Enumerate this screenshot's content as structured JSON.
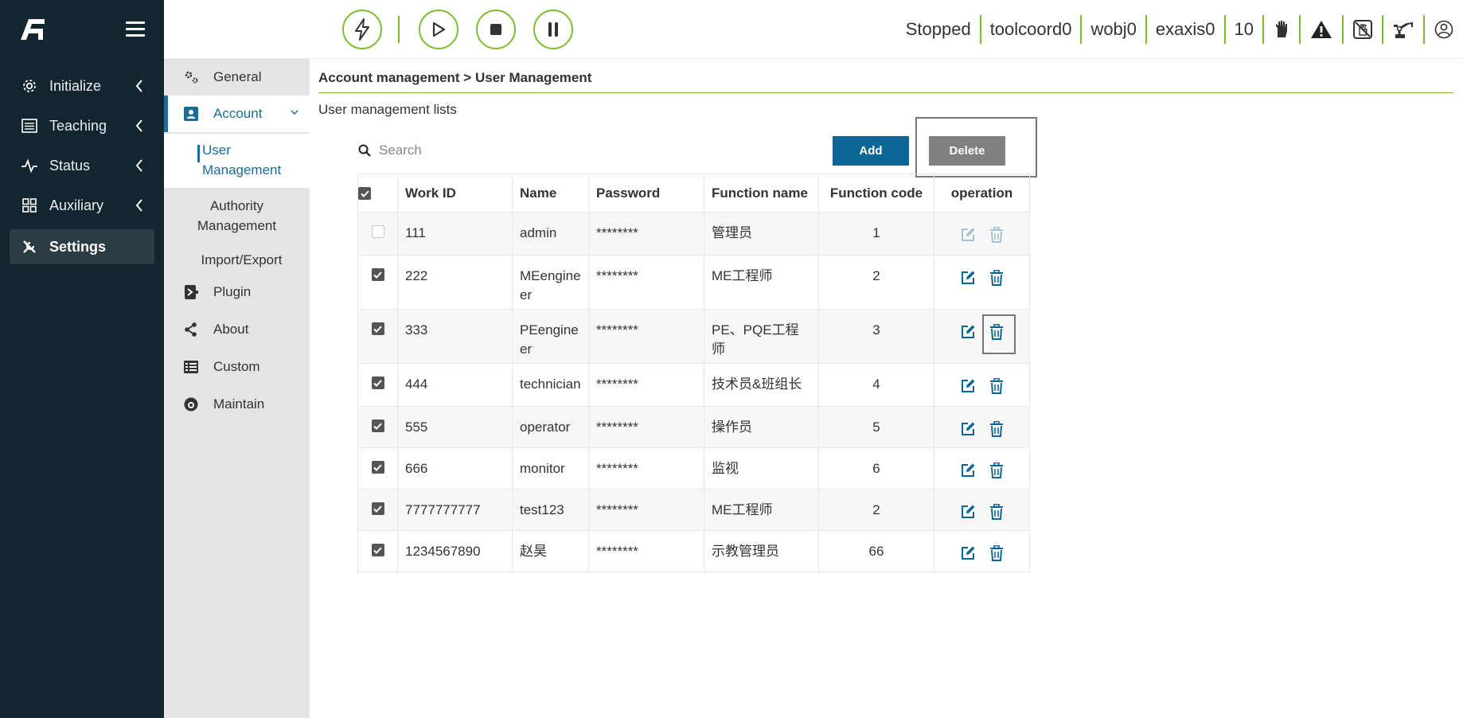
{
  "sidebar": {
    "items": [
      {
        "label": "Initialize",
        "icon": "gear-icon"
      },
      {
        "label": "Teaching",
        "icon": "list-icon"
      },
      {
        "label": "Status",
        "icon": "pulse-icon"
      },
      {
        "label": "Auxiliary",
        "icon": "grid-icon"
      },
      {
        "label": "Settings",
        "icon": "tools-icon"
      }
    ]
  },
  "topbar": {
    "status": "Stopped",
    "tool": "toolcoord0",
    "wobj": "wobj0",
    "exaxis": "exaxis0",
    "speed": "10"
  },
  "submenu": {
    "general": "General",
    "account": "Account",
    "user_management": "User Management",
    "authority_management": "Authority Management",
    "import_export": "Import/Export",
    "plugin": "Plugin",
    "about": "About",
    "custom": "Custom",
    "maintain": "Maintain"
  },
  "main": {
    "breadcrumb": "Account management > User Management",
    "list_title": "User management lists",
    "search_placeholder": "Search",
    "add_label": "Add",
    "delete_label": "Delete"
  },
  "table": {
    "headers": [
      "Work ID",
      "Name",
      "Password",
      "Function name",
      "Function code",
      "operation"
    ],
    "rows": [
      {
        "id": "111",
        "name": "admin",
        "password": "********",
        "function_name": "管理员",
        "function_code": "1",
        "checked": false
      },
      {
        "id": "222",
        "name": "MEengineer",
        "password": "********",
        "function_name": "ME工程师",
        "function_code": "2",
        "checked": true
      },
      {
        "id": "333",
        "name": "PEengineer",
        "password": "********",
        "function_name": "PE、PQE工程师",
        "function_code": "3",
        "checked": true
      },
      {
        "id": "444",
        "name": "technician",
        "password": "********",
        "function_name": "技术员&班组长",
        "function_code": "4",
        "checked": true
      },
      {
        "id": "555",
        "name": "operator",
        "password": "********",
        "function_name": "操作员",
        "function_code": "5",
        "checked": true
      },
      {
        "id": "666",
        "name": "monitor",
        "password": "********",
        "function_name": "监视",
        "function_code": "6",
        "checked": true
      },
      {
        "id": "7777777777",
        "name": "test123",
        "password": "********",
        "function_name": "ME工程师",
        "function_code": "2",
        "checked": true
      },
      {
        "id": "1234567890",
        "name": "赵昊",
        "password": "********",
        "function_name": "示教管理员",
        "function_code": "66",
        "checked": true
      }
    ]
  },
  "colors": {
    "sidebar_bg": "#13262f",
    "accent_green": "#7cbd2f",
    "accent_blue": "#0d6796"
  }
}
